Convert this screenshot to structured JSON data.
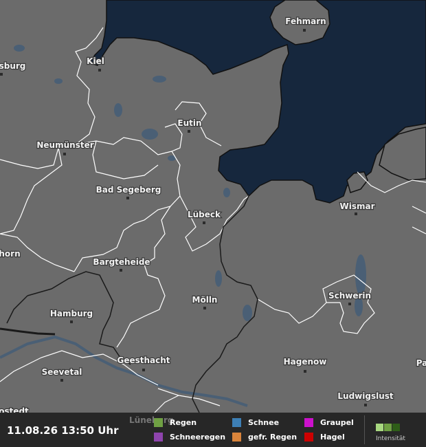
{
  "map": {
    "cities": [
      {
        "id": "fehmarn",
        "name": "Fehmarn"
      },
      {
        "id": "kiel",
        "name": "Kiel"
      },
      {
        "id": "rendsburg",
        "name": "sburg"
      },
      {
        "id": "eutin",
        "name": "Eutin"
      },
      {
        "id": "neumuenster",
        "name": "Neumünster"
      },
      {
        "id": "bad-segeberg",
        "name": "Bad Segeberg"
      },
      {
        "id": "wismar",
        "name": "Wismar"
      },
      {
        "id": "luebeck",
        "name": "Lübeck"
      },
      {
        "id": "elmshorn",
        "name": "horn"
      },
      {
        "id": "bargteheide",
        "name": "Bargteheide"
      },
      {
        "id": "schwerin",
        "name": "Schwerin"
      },
      {
        "id": "moelln",
        "name": "Mölln"
      },
      {
        "id": "hamburg",
        "name": "Hamburg"
      },
      {
        "id": "geesthacht",
        "name": "Geesthacht"
      },
      {
        "id": "hagenow",
        "name": "Hagenow"
      },
      {
        "id": "seevetal",
        "name": "Seevetal"
      },
      {
        "id": "parchim",
        "name": "Pa"
      },
      {
        "id": "ludwigslust",
        "name": "Ludwigslust"
      },
      {
        "id": "buxtehude",
        "name": "ostedt"
      },
      {
        "id": "lueneburg",
        "name": "Lüneburg"
      }
    ],
    "colors": {
      "land": "#6b6b6b",
      "sea": "#16273d",
      "borders": "#ffffff",
      "state_border": "#1a1a1a",
      "water": "#4a5f75"
    }
  },
  "footer": {
    "timestamp": "11.08.26 13:50 Uhr",
    "legend": [
      {
        "label": "Regen",
        "color": "#6fa043"
      },
      {
        "label": "Schnee",
        "color": "#3d7fb5"
      },
      {
        "label": "Graupel",
        "color": "#cc11cc"
      },
      {
        "label": "Schneeregen",
        "color": "#8e44ad"
      },
      {
        "label": "gefr. Regen",
        "color": "#d9843b"
      },
      {
        "label": "Hagel",
        "color": "#cc0000"
      }
    ],
    "intensity_label": "Intensität",
    "intensity_colors": [
      "#a8d880",
      "#6fa043",
      "#2f5e18"
    ]
  }
}
